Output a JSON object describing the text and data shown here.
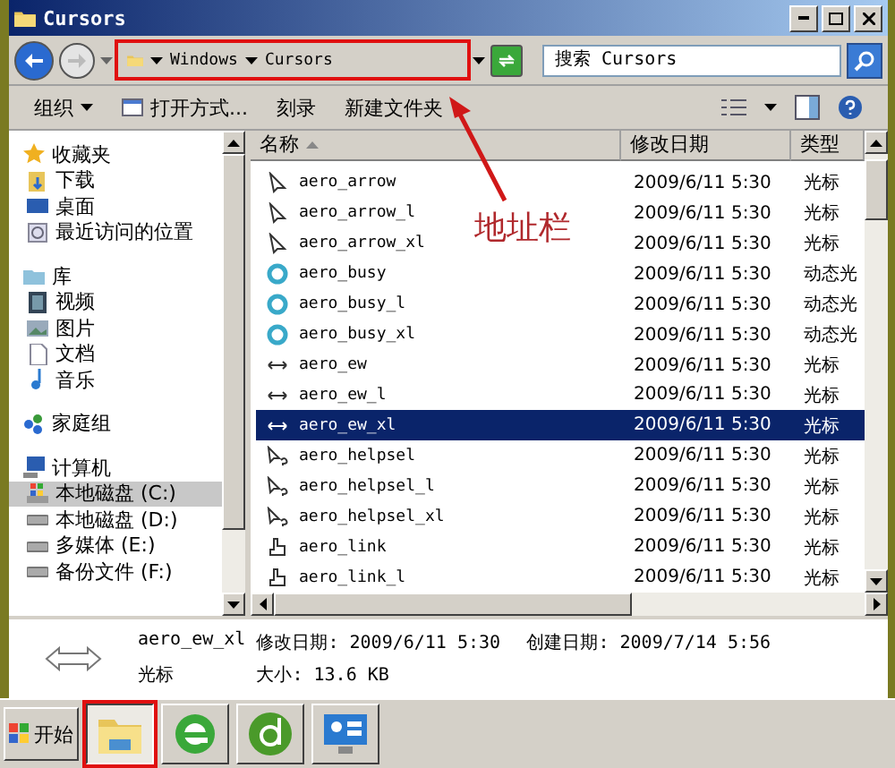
{
  "window": {
    "title": "Cursors"
  },
  "address_bar": {
    "crumbs": [
      "Windows",
      "Cursors"
    ],
    "highlighted": true
  },
  "search": {
    "placeholder": "搜索 Cursors"
  },
  "toolbar": [
    {
      "label": "组织",
      "kind": "menu"
    },
    {
      "label": "打开方式...",
      "kind": "open"
    },
    {
      "label": "刻录",
      "kind": "plain"
    },
    {
      "label": "新建文件夹",
      "kind": "plain"
    }
  ],
  "nav": [
    {
      "label": "收藏夹",
      "kind": "star",
      "selected": false,
      "children": [
        {
          "label": "下载",
          "kind": "download",
          "selected": false
        },
        {
          "label": "桌面",
          "kind": "desktop",
          "selected": false
        },
        {
          "label": "最近访问的位置",
          "kind": "recent",
          "selected": false
        }
      ]
    },
    {
      "label": "库",
      "kind": "library",
      "selected": false,
      "children": [
        {
          "label": "视频",
          "kind": "video",
          "selected": false
        },
        {
          "label": "图片",
          "kind": "picture",
          "selected": false
        },
        {
          "label": "文档",
          "kind": "document",
          "selected": false
        },
        {
          "label": "音乐",
          "kind": "music",
          "selected": false
        }
      ]
    },
    {
      "label": "家庭组",
      "kind": "homegroup",
      "selected": false
    },
    {
      "label": "计算机",
      "kind": "computer",
      "selected": false,
      "children": [
        {
          "label": "本地磁盘 (C:)",
          "kind": "sysdrive",
          "selected": true
        },
        {
          "label": "本地磁盘 (D:)",
          "kind": "drive",
          "selected": false
        },
        {
          "label": "多媒体 (E:)",
          "kind": "drive",
          "selected": false
        },
        {
          "label": "备份文件 (F:)",
          "kind": "drive",
          "selected": false
        }
      ]
    }
  ],
  "table": {
    "columns": [
      "名称",
      "修改日期",
      "类型"
    ],
    "rows": [
      {
        "name": "aero_arrow",
        "date": "2009/6/11 5:30",
        "type": "光标",
        "kind": "arrow",
        "selected": false
      },
      {
        "name": "aero_arrow_l",
        "date": "2009/6/11 5:30",
        "type": "光标",
        "kind": "arrow",
        "selected": false
      },
      {
        "name": "aero_arrow_xl",
        "date": "2009/6/11 5:30",
        "type": "光标",
        "kind": "arrow",
        "selected": false
      },
      {
        "name": "aero_busy",
        "date": "2009/6/11 5:30",
        "type": "动态光",
        "kind": "busy",
        "selected": false
      },
      {
        "name": "aero_busy_l",
        "date": "2009/6/11 5:30",
        "type": "动态光",
        "kind": "busy",
        "selected": false
      },
      {
        "name": "aero_busy_xl",
        "date": "2009/6/11 5:30",
        "type": "动态光",
        "kind": "busy",
        "selected": false
      },
      {
        "name": "aero_ew",
        "date": "2009/6/11 5:30",
        "type": "光标",
        "kind": "ew",
        "selected": false
      },
      {
        "name": "aero_ew_l",
        "date": "2009/6/11 5:30",
        "type": "光标",
        "kind": "ew",
        "selected": false
      },
      {
        "name": "aero_ew_xl",
        "date": "2009/6/11 5:30",
        "type": "光标",
        "kind": "ew",
        "selected": true
      },
      {
        "name": "aero_helpsel",
        "date": "2009/6/11 5:30",
        "type": "光标",
        "kind": "helpsel",
        "selected": false
      },
      {
        "name": "aero_helpsel_l",
        "date": "2009/6/11 5:30",
        "type": "光标",
        "kind": "helpsel",
        "selected": false
      },
      {
        "name": "aero_helpsel_xl",
        "date": "2009/6/11 5:30",
        "type": "光标",
        "kind": "helpsel",
        "selected": false
      },
      {
        "name": "aero_link",
        "date": "2009/6/11 5:30",
        "type": "光标",
        "kind": "link",
        "selected": false
      },
      {
        "name": "aero_link_l",
        "date": "2009/6/11 5:30",
        "type": "光标",
        "kind": "link",
        "selected": false
      }
    ]
  },
  "details": {
    "name": "aero_ew_xl",
    "type": "光标",
    "modified": "修改日期: 2009/6/11 5:30",
    "created": "创建日期: 2009/7/14 5:56",
    "size": "大小: 13.6 KB"
  },
  "annotation": {
    "label": "地址栏"
  },
  "taskbar": {
    "start": "开始",
    "items": [
      {
        "kind": "explorer",
        "selected": true,
        "highlighted": true
      },
      {
        "kind": "ie",
        "selected": false,
        "highlighted": false
      },
      {
        "kind": "dreamweaver",
        "selected": false,
        "highlighted": false
      },
      {
        "kind": "panel",
        "selected": false,
        "highlighted": false
      }
    ]
  }
}
